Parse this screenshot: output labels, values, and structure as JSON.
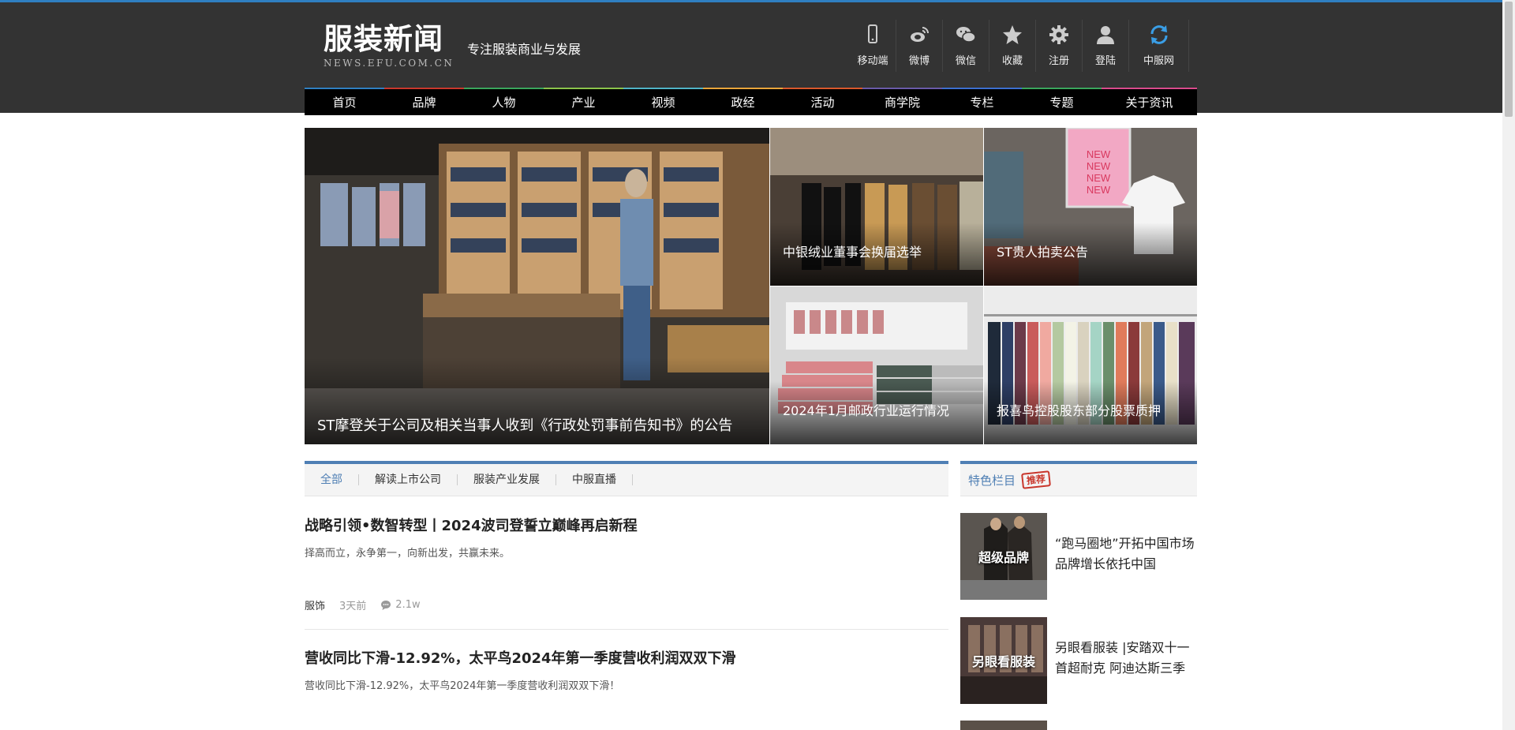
{
  "header": {
    "logo_cn": "服装新闻",
    "logo_en": "NEWS.EFU.COM.CN",
    "slogan": "专注服装商业与发展",
    "tools": [
      {
        "label": "移动端",
        "icon": "mobile-icon"
      },
      {
        "label": "微博",
        "icon": "weibo-icon"
      },
      {
        "label": "微信",
        "icon": "wechat-icon"
      },
      {
        "label": "收藏",
        "icon": "star-icon"
      },
      {
        "label": "注册",
        "icon": "gear-icon"
      },
      {
        "label": "登陆",
        "icon": "user-icon"
      },
      {
        "label": "中服网",
        "icon": "refresh-icon"
      }
    ]
  },
  "nav": {
    "items": [
      {
        "label": "首页",
        "color": "#2f7fc1"
      },
      {
        "label": "品牌",
        "color": "#c9372c"
      },
      {
        "label": "人物",
        "color": "#3aa55c"
      },
      {
        "label": "产业",
        "color": "#8bc34a"
      },
      {
        "label": "视频",
        "color": "#4fb3c6"
      },
      {
        "label": "政经",
        "color": "#e8a43a"
      },
      {
        "label": "活动",
        "color": "#d9582b"
      },
      {
        "label": "商学院",
        "color": "#6a5aa8"
      },
      {
        "label": "专栏",
        "color": "#3c6fd0"
      },
      {
        "label": "专题",
        "color": "#3aa55c"
      },
      {
        "label": "关于资讯",
        "color": "#d94a8c"
      }
    ]
  },
  "featured": {
    "main": "ST摩登关于公司及相关当事人收到《行政处罚事前告知书》的公告",
    "top_left": "中银绒业董事会换届选举",
    "top_right": "ST贵人拍卖公告",
    "bottom_left": "2024年1月邮政行业运行情况",
    "bottom_right": "报喜鸟控股股东部分股票质押"
  },
  "tabs": [
    "全部",
    "解读上市公司",
    "服装产业发展",
    "中服直播"
  ],
  "articles": [
    {
      "title": "战略引领•数智转型丨2024波司登誓立巅峰再启新程",
      "desc": "择高而立，永争第一，向新出发，共赢未来。",
      "category": "服饰",
      "time": "3天前",
      "comments": "2.1w"
    },
    {
      "title": "营收同比下滑-12.92%，太平鸟2024年第一季度营收利润双双下滑",
      "desc": "营收同比下滑-12.92%，太平鸟2024年第一季度营收利润双双下滑！"
    }
  ],
  "sidebar": {
    "title": "特色栏目",
    "stamp": "推荐",
    "items": [
      {
        "thumb_label": "超级品牌",
        "text": "“跑马圈地”开拓中国市场 品牌增长依托中国"
      },
      {
        "thumb_label": "另眼看服装",
        "text": "另眼看服装 |安踏双十一首超耐克 阿迪达斯三季"
      }
    ]
  }
}
